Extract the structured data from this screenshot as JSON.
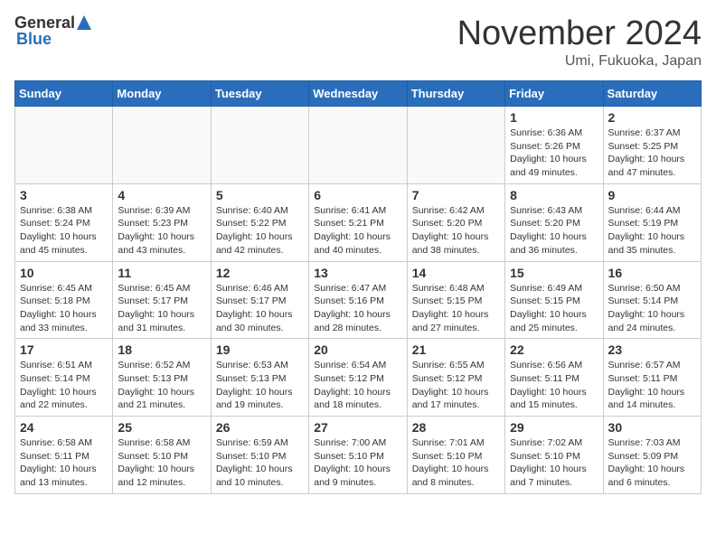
{
  "header": {
    "logo_general": "General",
    "logo_blue": "Blue",
    "month": "November 2024",
    "location": "Umi, Fukuoka, Japan"
  },
  "weekdays": [
    "Sunday",
    "Monday",
    "Tuesday",
    "Wednesday",
    "Thursday",
    "Friday",
    "Saturday"
  ],
  "weeks": [
    [
      {
        "day": "",
        "info": ""
      },
      {
        "day": "",
        "info": ""
      },
      {
        "day": "",
        "info": ""
      },
      {
        "day": "",
        "info": ""
      },
      {
        "day": "",
        "info": ""
      },
      {
        "day": "1",
        "info": "Sunrise: 6:36 AM\nSunset: 5:26 PM\nDaylight: 10 hours and 49 minutes."
      },
      {
        "day": "2",
        "info": "Sunrise: 6:37 AM\nSunset: 5:25 PM\nDaylight: 10 hours and 47 minutes."
      }
    ],
    [
      {
        "day": "3",
        "info": "Sunrise: 6:38 AM\nSunset: 5:24 PM\nDaylight: 10 hours and 45 minutes."
      },
      {
        "day": "4",
        "info": "Sunrise: 6:39 AM\nSunset: 5:23 PM\nDaylight: 10 hours and 43 minutes."
      },
      {
        "day": "5",
        "info": "Sunrise: 6:40 AM\nSunset: 5:22 PM\nDaylight: 10 hours and 42 minutes."
      },
      {
        "day": "6",
        "info": "Sunrise: 6:41 AM\nSunset: 5:21 PM\nDaylight: 10 hours and 40 minutes."
      },
      {
        "day": "7",
        "info": "Sunrise: 6:42 AM\nSunset: 5:20 PM\nDaylight: 10 hours and 38 minutes."
      },
      {
        "day": "8",
        "info": "Sunrise: 6:43 AM\nSunset: 5:20 PM\nDaylight: 10 hours and 36 minutes."
      },
      {
        "day": "9",
        "info": "Sunrise: 6:44 AM\nSunset: 5:19 PM\nDaylight: 10 hours and 35 minutes."
      }
    ],
    [
      {
        "day": "10",
        "info": "Sunrise: 6:45 AM\nSunset: 5:18 PM\nDaylight: 10 hours and 33 minutes."
      },
      {
        "day": "11",
        "info": "Sunrise: 6:45 AM\nSunset: 5:17 PM\nDaylight: 10 hours and 31 minutes."
      },
      {
        "day": "12",
        "info": "Sunrise: 6:46 AM\nSunset: 5:17 PM\nDaylight: 10 hours and 30 minutes."
      },
      {
        "day": "13",
        "info": "Sunrise: 6:47 AM\nSunset: 5:16 PM\nDaylight: 10 hours and 28 minutes."
      },
      {
        "day": "14",
        "info": "Sunrise: 6:48 AM\nSunset: 5:15 PM\nDaylight: 10 hours and 27 minutes."
      },
      {
        "day": "15",
        "info": "Sunrise: 6:49 AM\nSunset: 5:15 PM\nDaylight: 10 hours and 25 minutes."
      },
      {
        "day": "16",
        "info": "Sunrise: 6:50 AM\nSunset: 5:14 PM\nDaylight: 10 hours and 24 minutes."
      }
    ],
    [
      {
        "day": "17",
        "info": "Sunrise: 6:51 AM\nSunset: 5:14 PM\nDaylight: 10 hours and 22 minutes."
      },
      {
        "day": "18",
        "info": "Sunrise: 6:52 AM\nSunset: 5:13 PM\nDaylight: 10 hours and 21 minutes."
      },
      {
        "day": "19",
        "info": "Sunrise: 6:53 AM\nSunset: 5:13 PM\nDaylight: 10 hours and 19 minutes."
      },
      {
        "day": "20",
        "info": "Sunrise: 6:54 AM\nSunset: 5:12 PM\nDaylight: 10 hours and 18 minutes."
      },
      {
        "day": "21",
        "info": "Sunrise: 6:55 AM\nSunset: 5:12 PM\nDaylight: 10 hours and 17 minutes."
      },
      {
        "day": "22",
        "info": "Sunrise: 6:56 AM\nSunset: 5:11 PM\nDaylight: 10 hours and 15 minutes."
      },
      {
        "day": "23",
        "info": "Sunrise: 6:57 AM\nSunset: 5:11 PM\nDaylight: 10 hours and 14 minutes."
      }
    ],
    [
      {
        "day": "24",
        "info": "Sunrise: 6:58 AM\nSunset: 5:11 PM\nDaylight: 10 hours and 13 minutes."
      },
      {
        "day": "25",
        "info": "Sunrise: 6:58 AM\nSunset: 5:10 PM\nDaylight: 10 hours and 12 minutes."
      },
      {
        "day": "26",
        "info": "Sunrise: 6:59 AM\nSunset: 5:10 PM\nDaylight: 10 hours and 10 minutes."
      },
      {
        "day": "27",
        "info": "Sunrise: 7:00 AM\nSunset: 5:10 PM\nDaylight: 10 hours and 9 minutes."
      },
      {
        "day": "28",
        "info": "Sunrise: 7:01 AM\nSunset: 5:10 PM\nDaylight: 10 hours and 8 minutes."
      },
      {
        "day": "29",
        "info": "Sunrise: 7:02 AM\nSunset: 5:10 PM\nDaylight: 10 hours and 7 minutes."
      },
      {
        "day": "30",
        "info": "Sunrise: 7:03 AM\nSunset: 5:09 PM\nDaylight: 10 hours and 6 minutes."
      }
    ]
  ]
}
